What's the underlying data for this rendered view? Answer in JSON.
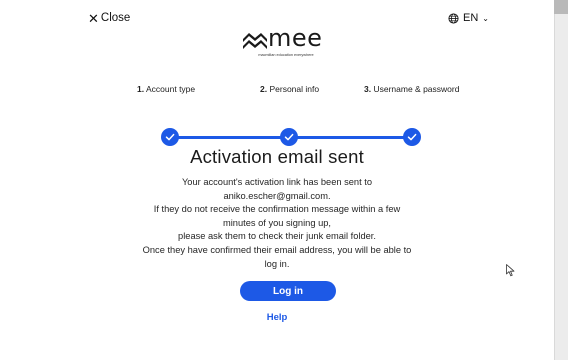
{
  "header": {
    "close_label": "Close",
    "language_label": "EN",
    "close_icon": "close-icon",
    "language_icon": "globe-icon"
  },
  "logo": {
    "word": "mee",
    "tagline": "macmillan education everywhere"
  },
  "stepper": {
    "steps": [
      {
        "number": "1.",
        "label": "Account type",
        "completed": true
      },
      {
        "number": "2.",
        "label": "Personal info",
        "completed": true
      },
      {
        "number": "3.",
        "label": "Username & password",
        "completed": true
      }
    ],
    "icon": "checkmark-icon",
    "accent_color": "#1d59e6"
  },
  "main": {
    "title": "Activation email sent",
    "message_lines": [
      "Your account's activation link has been sent to",
      "aniko.escher@gmail.com.",
      "If they do not receive the confirmation message within a few",
      "minutes of you signing up,",
      "please ask them to check their junk email folder.",
      "Once they have confirmed their email address, you will be able to",
      "log in."
    ],
    "login_label": "Log in",
    "help_label": "Help"
  },
  "colors": {
    "primary": "#1d59e6",
    "background": "#ffffff",
    "text": "#222222"
  }
}
